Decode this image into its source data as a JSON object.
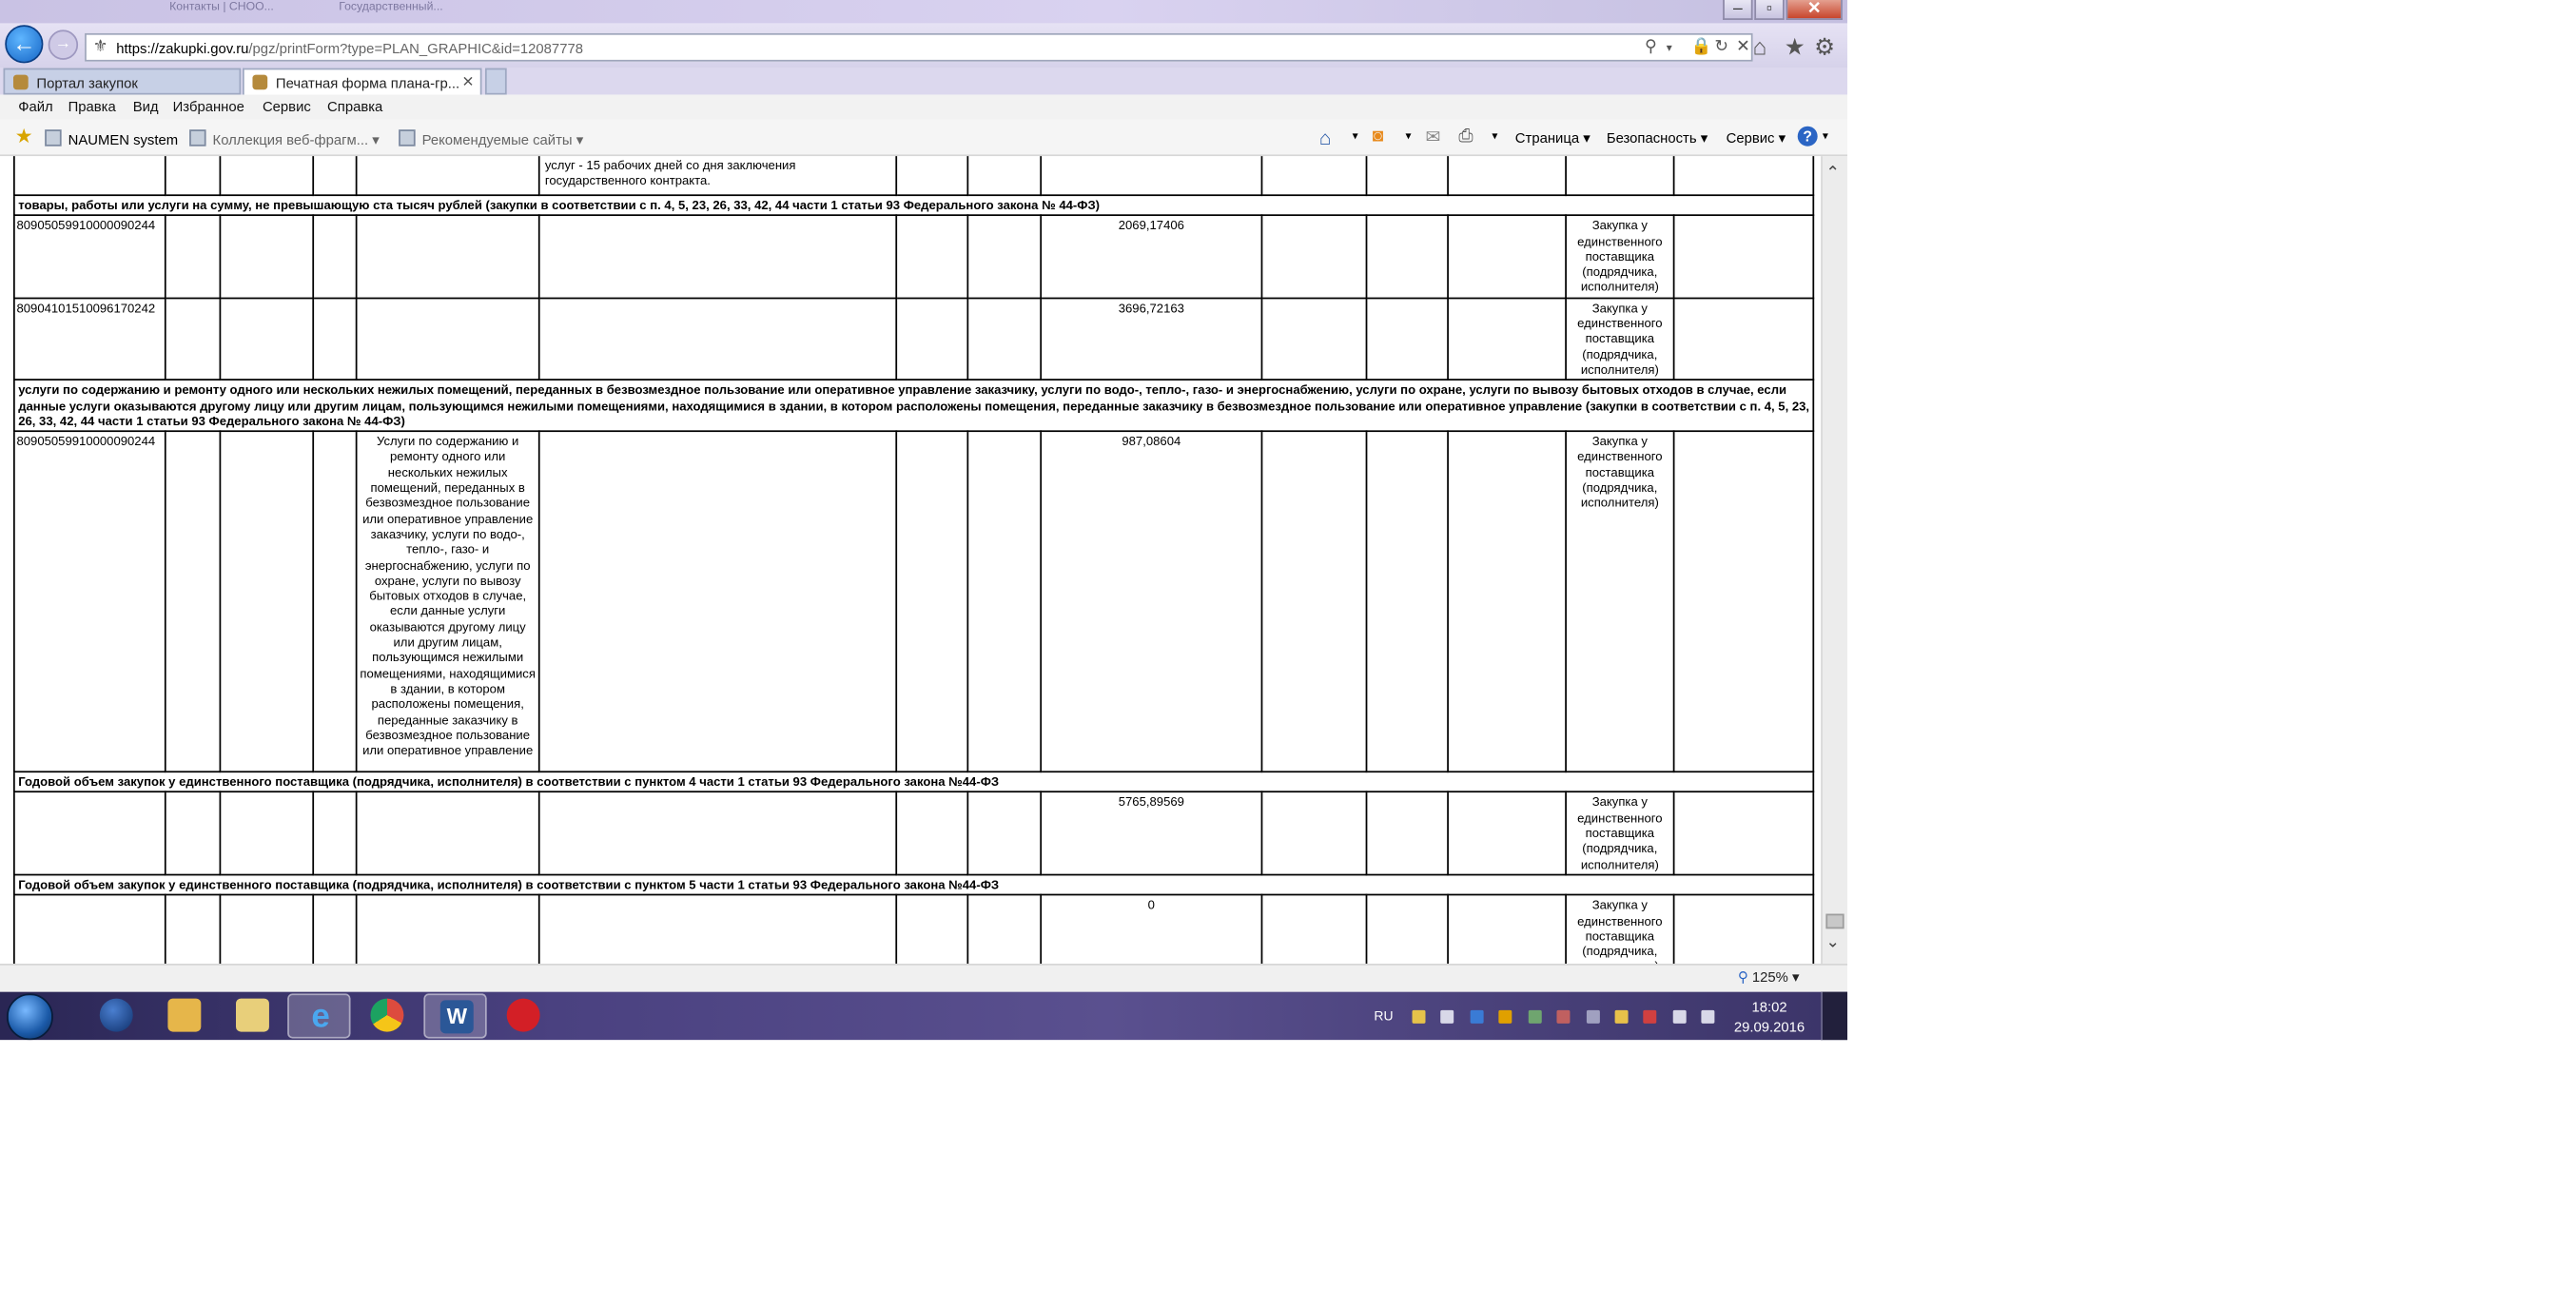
{
  "browser": {
    "url_host": "https://zakupki.gov.ru",
    "url_path": "/pgz/printForm?type=PLAN_GRAPHIC&id=12087778",
    "ghost_tabs": [
      "Контакты | СНОО...",
      "Государственный..."
    ],
    "tabs": [
      {
        "label": "Портал закупок",
        "active": false
      },
      {
        "label": "Печатная форма плана-гр...",
        "active": true
      }
    ],
    "menu": [
      "Файл",
      "Правка",
      "Вид",
      "Избранное",
      "Сервис",
      "Справка"
    ],
    "favorites": [
      "NAUMEN system",
      "Коллекция веб-фрагм...",
      "Рекомендуемые сайты"
    ],
    "commandbar": [
      "Страница",
      "Безопасность",
      "Сервис"
    ],
    "zoom": "125%"
  },
  "table": {
    "top_cell_text": "услуг - 15 рабочих дней со дня заключения государственного контракта.",
    "section1_title": "товары, работы или услуги на сумму, не превышающую ста тысяч рублей (закупки в соответствии с п. 4, 5, 23, 26, 33, 42, 44 части 1 статьи 93 Федерального закона № 44-ФЗ)",
    "method": "Закупка у единственного поставщика (подрядчика, исполнителя)",
    "rows1": [
      {
        "code": "80905059910000090244",
        "sum": "2069,17406"
      },
      {
        "code": "80904101510096170242",
        "sum": "3696,72163"
      }
    ],
    "section2_title": "услуги по содержанию и ремонту одного или нескольких нежилых помещений, переданных в безвозмездное пользование или оперативное управление заказчику, услуги по водо-, тепло-, газо- и энергоснабжению, услуги по охране, услуги по вывозу бытовых отходов в случае, если данные услуги оказываются другому лицу или другим лицам, пользующимся нежилыми помещениями, находящимися в здании, в котором расположены помещения, переданные заказчику в безвозмездное пользование или оперативное управление (закупки в соответствии с п. 4, 5, 23, 26, 33, 42, 44 части 1 статьи 93 Федерального закона № 44-ФЗ)",
    "row2": {
      "code": "80905059910000090244",
      "name": "Услуги по содержанию и ремонту одного или нескольких нежилых помещений, переданных в безвозмездное пользование или оперативное управление заказчику, услуги по водо-, тепло-, газо- и энергоснабжению, услуги по охране, услуги по вывозу бытовых отходов в случае, если данные услуги оказываются другому лицу или другим лицам, пользующимся нежилыми помещениями, находящимися в здании, в котором расположены помещения, переданные заказчику в безвозмездное пользование или оперативное управление",
      "sum": "987,08604"
    },
    "section3_title": "Годовой объем закупок у единственного поставщика (подрядчика, исполнителя) в соответствии с пунктом 4 части 1 статьи 93 Федерального закона №44-ФЗ",
    "row3_sum": "5765,89569",
    "section4_title": "Годовой объем закупок у единственного поставщика (подрядчика, исполнителя) в соответствии с пунктом 5 части 1 статьи 93 Федерального закона №44-ФЗ",
    "row4_sum": "0"
  },
  "taskbar": {
    "lang": "RU",
    "time": "18:02",
    "date": "29.09.2016",
    "word_label": "W"
  },
  "colors": {
    "accent_blue": "#1666c6",
    "taskbar": "#4a4180"
  }
}
